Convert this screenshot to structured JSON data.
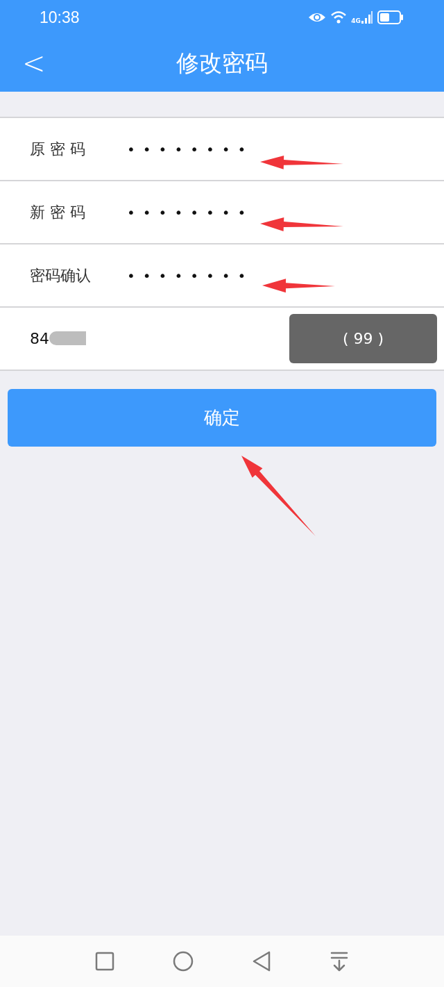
{
  "status_bar": {
    "time": "10:38",
    "network": "4G"
  },
  "header": {
    "back": "<",
    "title": "修改密码"
  },
  "form": {
    "rows": [
      {
        "kind": "password",
        "label": "原 密 码",
        "value": "••••••••"
      },
      {
        "kind": "password",
        "label": "新 密 码",
        "value": "••••••••"
      },
      {
        "kind": "password",
        "label": "密码确认",
        "value": "••••••••"
      },
      {
        "kind": "code",
        "value": "84",
        "redacted": true,
        "button": "( 99 )",
        "disabled": true
      }
    ]
  },
  "confirm_button": "确定"
}
